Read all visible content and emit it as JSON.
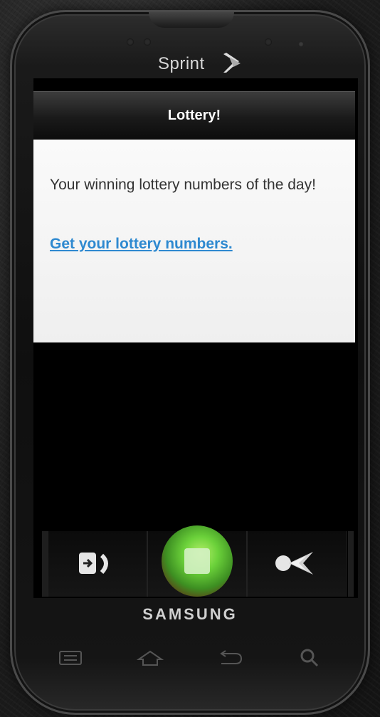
{
  "device": {
    "carrier": "Sprint",
    "brand": "SAMSUNG"
  },
  "app": {
    "title": "Lottery!",
    "intro": "Your winning lottery numbers of the day!",
    "link_label": "Get your lottery numbers."
  },
  "dock": {
    "items": [
      {
        "icon": "exit-door-icon"
      },
      {
        "icon": "green-square-button-icon"
      },
      {
        "icon": "share-icon"
      }
    ]
  },
  "hardware_keys": [
    {
      "icon": "menu-icon"
    },
    {
      "icon": "home-icon"
    },
    {
      "icon": "back-icon"
    },
    {
      "icon": "search-icon"
    }
  ],
  "colors": {
    "link": "#2e89d0",
    "header_text": "#ffffff",
    "body_text": "#333333",
    "content_bg": "#f5f5f5",
    "screen_bg": "#000000"
  }
}
